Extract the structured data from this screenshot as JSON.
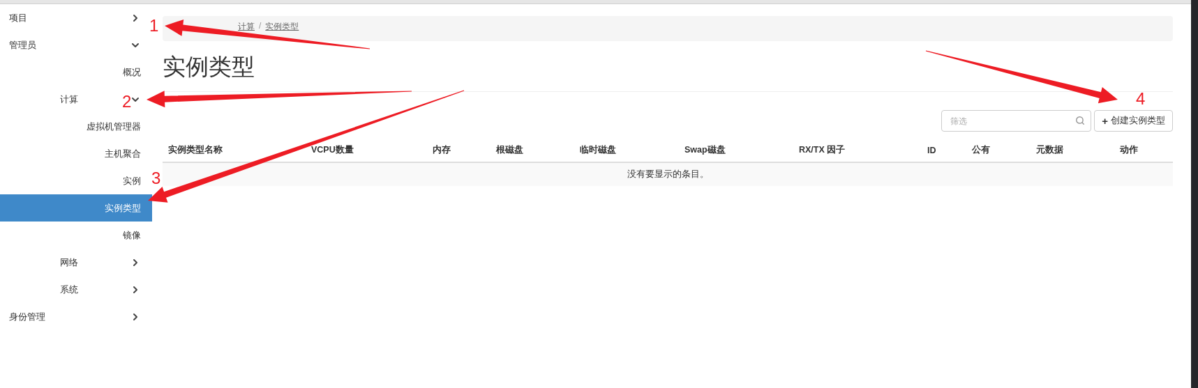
{
  "sidebar": {
    "items": [
      {
        "kind": "group",
        "label": "项目",
        "expanded": false
      },
      {
        "kind": "group",
        "label": "管理员",
        "expanded": true,
        "children": [
          {
            "kind": "link",
            "label": "概况",
            "selected": false
          },
          {
            "kind": "group",
            "label": "计算",
            "expanded": true,
            "children": [
              {
                "kind": "link",
                "label": "虚拟机管理器",
                "selected": false
              },
              {
                "kind": "link",
                "label": "主机聚合",
                "selected": false
              },
              {
                "kind": "link",
                "label": "实例",
                "selected": false
              },
              {
                "kind": "link",
                "label": "实例类型",
                "selected": true
              },
              {
                "kind": "link",
                "label": "镜像",
                "selected": false
              }
            ]
          },
          {
            "kind": "group",
            "label": "网络",
            "expanded": false
          },
          {
            "kind": "group",
            "label": "系统",
            "expanded": false
          }
        ]
      },
      {
        "kind": "group",
        "label": "身份管理",
        "expanded": false
      }
    ]
  },
  "breadcrumb": {
    "separator": "/",
    "items": [
      "计算",
      "实例类型"
    ]
  },
  "page_title": "实例类型",
  "filter": {
    "placeholder": "筛选"
  },
  "create_button": {
    "icon": "+",
    "label": "创建实例类型"
  },
  "table": {
    "columns": [
      "实例类型名称",
      "VCPU数量",
      "内存",
      "根磁盘",
      "临时磁盘",
      "Swap磁盘",
      "RX/TX 因子",
      "ID",
      "公有",
      "元数据",
      "动作"
    ],
    "empty_message": "没有要显示的条目。"
  },
  "annotations": [
    {
      "label": "1"
    },
    {
      "label": "2"
    },
    {
      "label": "3"
    },
    {
      "label": "4"
    }
  ]
}
